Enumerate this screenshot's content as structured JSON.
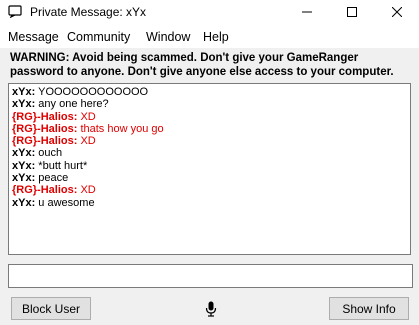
{
  "window": {
    "title": "Private Message: xYx",
    "icon": "gameranger-icon",
    "controls": [
      "minimize-icon",
      "maximize-icon",
      "close-icon"
    ]
  },
  "menu": {
    "items": [
      {
        "label": "Message"
      },
      {
        "label": "Community"
      },
      {
        "label": "Window"
      },
      {
        "label": "Help"
      }
    ]
  },
  "warning": {
    "text": "WARNING: Avoid being scammed. Don't give your GameRanger password to anyone. Don't give anyone else access to your computer."
  },
  "chat": {
    "messages": [
      {
        "nick": "xYx:",
        "text": " YOOOOOOOOOOOO",
        "color": "#000000"
      },
      {
        "nick": "xYx:",
        "text": " any one here?",
        "color": "#000000"
      },
      {
        "nick": "{RG}-Halios:",
        "text": " XD",
        "color": "#e00000"
      },
      {
        "nick": "{RG}-Halios:",
        "text": " thats how you go",
        "color": "#e00000"
      },
      {
        "nick": "{RG}-Halios:",
        "text": " XD",
        "color": "#e00000"
      },
      {
        "nick": "xYx:",
        "text": " ouch",
        "color": "#000000"
      },
      {
        "nick": "xYx:",
        "text": " *butt hurt*",
        "color": "#000000"
      },
      {
        "nick": "xYx:",
        "text": " peace",
        "color": "#000000"
      },
      {
        "nick": "{RG}-Halios:",
        "text": " XD",
        "color": "#e00000"
      },
      {
        "nick": "xYx:",
        "text": " u awesome",
        "color": "#000000"
      }
    ]
  },
  "input": {
    "value": "",
    "placeholder": ""
  },
  "buttons": {
    "block_user": "Block User",
    "show_info": "Show Info",
    "mic_icon": "microphone-icon"
  }
}
